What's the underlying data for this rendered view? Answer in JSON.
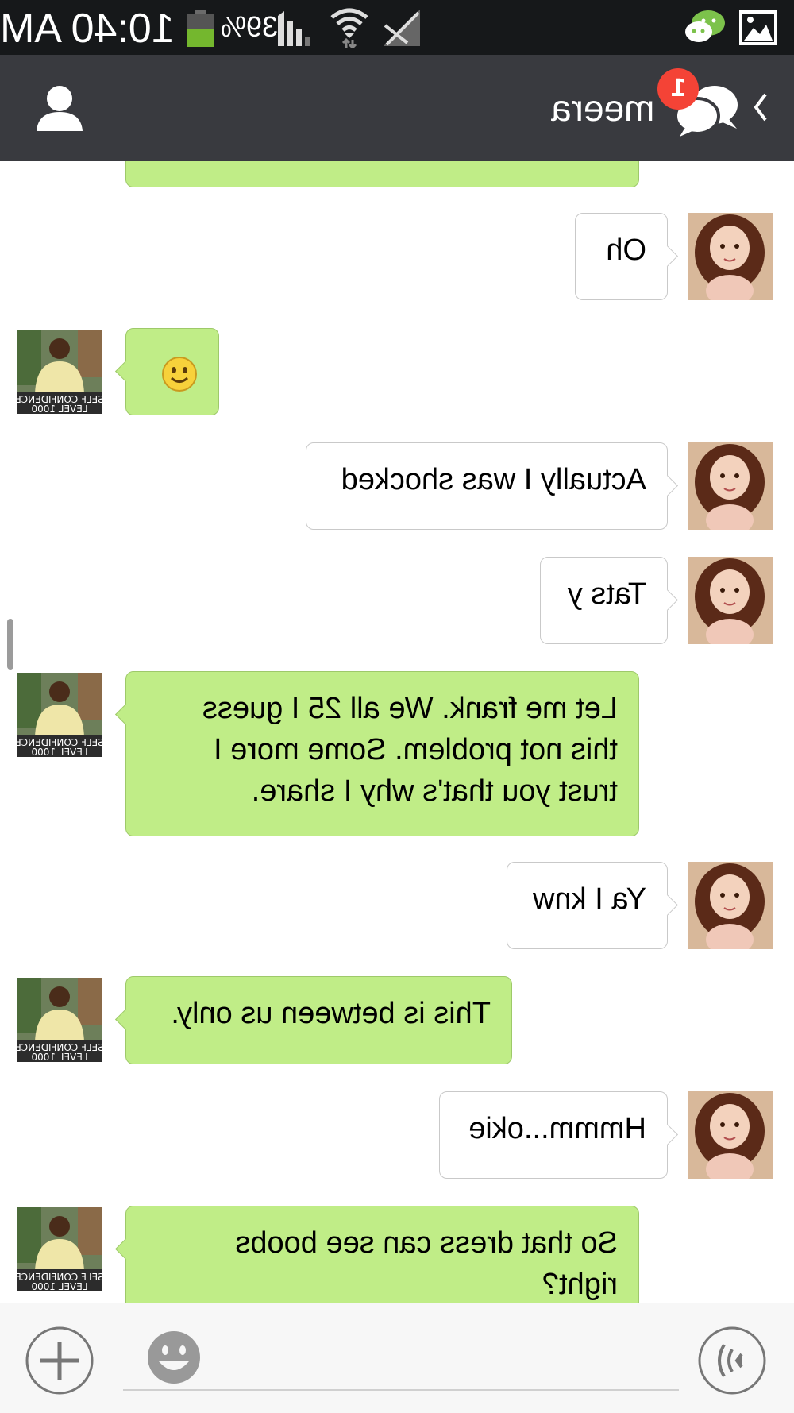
{
  "status_bar": {
    "time": "10:40 AM",
    "battery": "39%",
    "icons": [
      "battery-icon",
      "signal-icon",
      "wifi-icon",
      "no-data-icon",
      "wechat-icon",
      "image-icon"
    ]
  },
  "header": {
    "contact_name": "meera",
    "unread_count": "1",
    "icons": [
      "contact-profile-icon",
      "chats-icon",
      "back-icon"
    ]
  },
  "colors": {
    "header_bg": "#393a3f",
    "status_bg": "#16181a",
    "sent_bubble": "#c0ed87",
    "received_bubble": "#ffffff",
    "badge": "#f44336"
  },
  "messages": [
    {
      "side": "left",
      "text": "",
      "type": "text-partial"
    },
    {
      "side": "right",
      "text": "Oh",
      "type": "text"
    },
    {
      "side": "left",
      "text": "☺",
      "type": "emoji"
    },
    {
      "side": "right",
      "text": "Actually I was shocked",
      "type": "text"
    },
    {
      "side": "right",
      "text": "Tats y",
      "type": "text"
    },
    {
      "side": "left",
      "text": "Let me frank. We all 25 I guess\nthis not problem. Some more I\ntrust you that's why I share.",
      "type": "text"
    },
    {
      "side": "right",
      "text": "Ya I knw",
      "type": "text"
    },
    {
      "side": "left",
      "text": "This is between us only.",
      "type": "text"
    },
    {
      "side": "right",
      "text": "Hmmm...okie",
      "type": "text"
    },
    {
      "side": "left",
      "text": "So that dress can see boobs\nright?",
      "type": "text"
    }
  ],
  "avatars": {
    "left_caption": "SELF CONFIDENCE LEVEL 1000"
  },
  "input": {
    "placeholder": "",
    "icons": [
      "plus-icon",
      "emoji-icon",
      "voice-icon"
    ]
  }
}
